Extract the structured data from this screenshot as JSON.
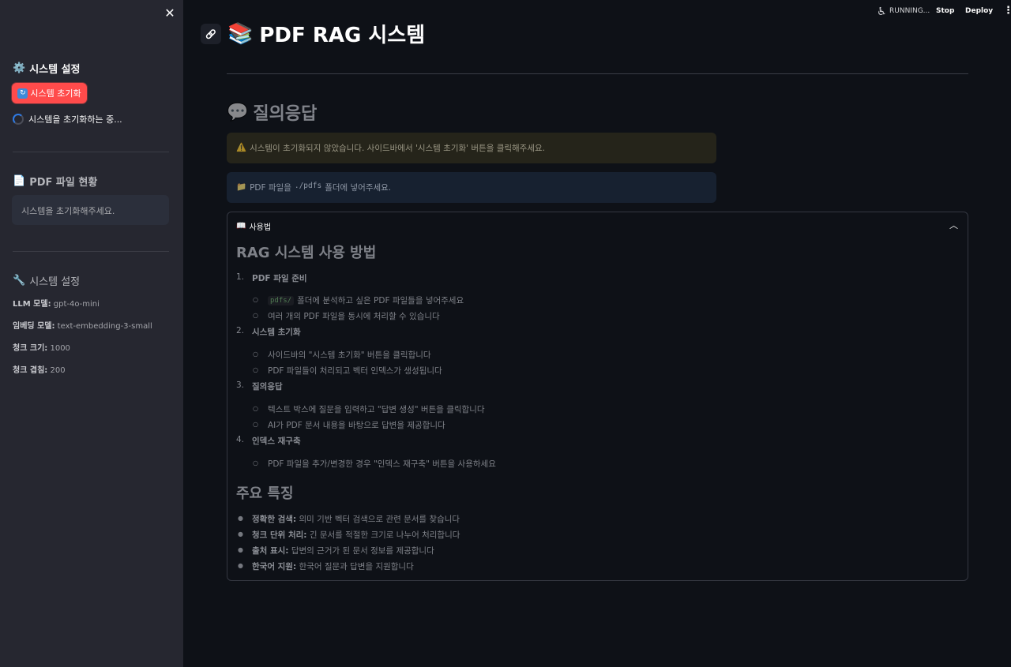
{
  "topbar": {
    "status": "RUNNING...",
    "stop": "Stop",
    "deploy": "Deploy",
    "menu": "⋮"
  },
  "sidebar": {
    "close": "✕",
    "settings_heading": "시스템 설정",
    "settings_icon": "⚙️",
    "init_button": "시스템 초기화",
    "init_button_icon": "🔄",
    "spinner_text": "시스템을 초기화하는 중...",
    "pdf_heading": "PDF 파일 현황",
    "pdf_icon": "📄",
    "pdf_status": "시스템을 초기화해주세요.",
    "config_heading": "시스템 설정",
    "config_icon": "🔧",
    "config": [
      {
        "key": "LLM 모델:",
        "value": "gpt-4o-mini"
      },
      {
        "key": "임베딩 모델:",
        "value": "text-embedding-3-small"
      },
      {
        "key": "청크 크기:",
        "value": "1000"
      },
      {
        "key": "청크 겹침:",
        "value": "200"
      }
    ]
  },
  "main": {
    "title": "PDF RAG 시스템",
    "title_icon": "📚",
    "anchor_icon": "🔗",
    "section_title": "질의응답",
    "section_icon": "💬",
    "warning": {
      "icon": "⚠️",
      "text": "시스템이 초기화되지 않았습니다. 사이드바에서 '시스템 초기화' 버튼을 클릭해주세요."
    },
    "info": {
      "icon": "📁",
      "prefix": "PDF 파일을",
      "code": "./pdfs",
      "suffix": "폴더에 넣어주세요."
    },
    "expander": {
      "icon": "📖",
      "label": "사용법",
      "chevron": "⌃",
      "h2_usage": "RAG 시스템 사용 방법",
      "steps": [
        {
          "num": "1.",
          "label": "PDF 파일 준비",
          "subs": [
            {
              "code": "pdfs/",
              "text": "폴더에 분석하고 싶은 PDF 파일들을 넣어주세요"
            },
            {
              "code": "",
              "text": "여러 개의 PDF 파일을 동시에 처리할 수 있습니다"
            }
          ]
        },
        {
          "num": "2.",
          "label": "시스템 초기화",
          "subs": [
            {
              "code": "",
              "text": "사이드바의 \"시스템 초기화\" 버튼을 클릭합니다"
            },
            {
              "code": "",
              "text": "PDF 파일들이 처리되고 벡터 인덱스가 생성됩니다"
            }
          ]
        },
        {
          "num": "3.",
          "label": "질의응답",
          "subs": [
            {
              "code": "",
              "text": "텍스트 박스에 질문을 입력하고 \"답변 생성\" 버튼을 클릭합니다"
            },
            {
              "code": "",
              "text": "AI가 PDF 문서 내용을 바탕으로 답변을 제공합니다"
            }
          ]
        },
        {
          "num": "4.",
          "label": "인덱스 재구축",
          "subs": [
            {
              "code": "",
              "text": "PDF 파일을 추가/변경한 경우 \"인덱스 재구축\" 버튼을 사용하세요"
            }
          ]
        }
      ],
      "h2_features": "주요 특징",
      "features": [
        {
          "bold": "정확한 검색:",
          "text": "의미 기반 벡터 검색으로 관련 문서를 찾습니다"
        },
        {
          "bold": "청크 단위 처리:",
          "text": "긴 문서를 적절한 크기로 나누어 처리합니다"
        },
        {
          "bold": "출처 표시:",
          "text": "답변의 근거가 된 문서 정보를 제공합니다"
        },
        {
          "bold": "한국어 지원:",
          "text": "한국어 질문과 답변을 지원합니다"
        }
      ]
    }
  }
}
